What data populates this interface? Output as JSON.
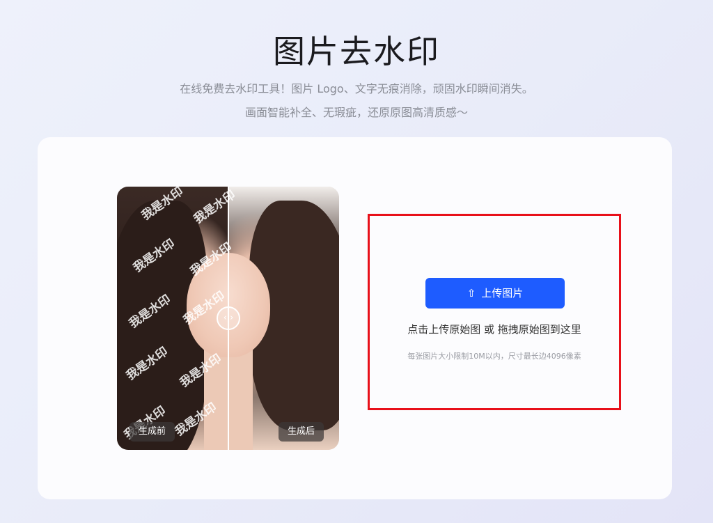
{
  "header": {
    "title": "图片去水印",
    "subtitle_line1": "在线免费去水印工具！图片 Logo、文字无痕消除，顽固水印瞬间消失。",
    "subtitle_line2": "画面智能补全、无瑕疵，还原原图高清质感～"
  },
  "preview": {
    "watermark_text": "我是水印",
    "before_label": "生成前",
    "after_label": "生成后",
    "compare_handle_icon": "left-right-arrows-icon"
  },
  "upload": {
    "button_label": "上传图片",
    "button_icon": "upload-icon",
    "hint": "点击上传原始图 或 拖拽原始图到这里",
    "limit": "每张图片大小限制10M以内，尺寸最长边4096像素",
    "highlight_color": "#e8101a",
    "button_color": "#1e5cff"
  }
}
